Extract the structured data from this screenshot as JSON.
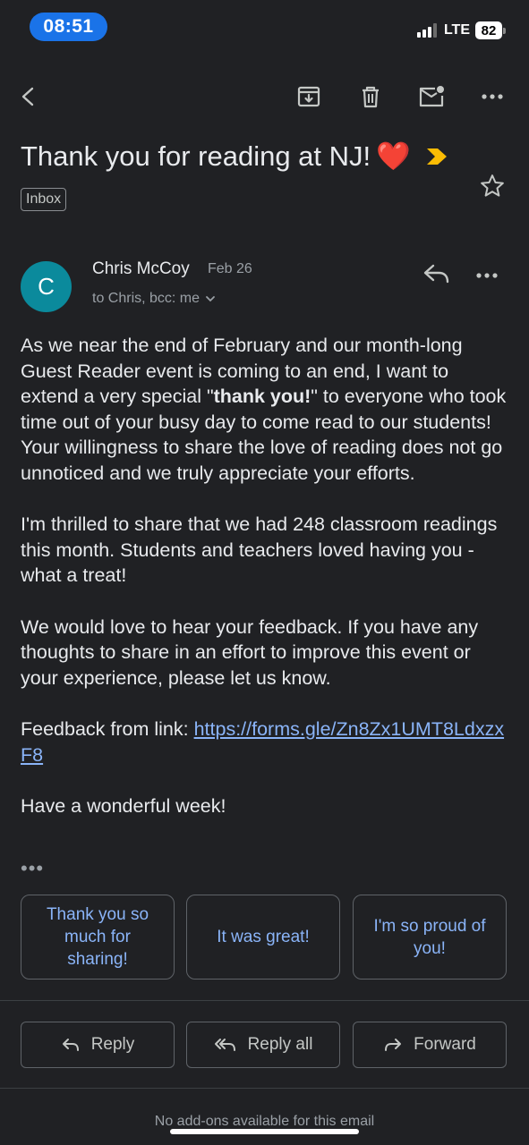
{
  "status_bar": {
    "time": "08:51",
    "network": "LTE",
    "battery": "82"
  },
  "toolbar": {
    "back": "back-icon",
    "archive": "archive-icon",
    "delete": "trash-icon",
    "mark_unread": "mail-unread-icon",
    "more": "more-icon"
  },
  "email": {
    "subject": "Thank you for reading at NJ!",
    "subject_emoji": "❤️",
    "label": "Inbox",
    "sender": {
      "initial": "C",
      "name": "Chris McCoy",
      "date": "Feb 26",
      "recipients": "to Chris, bcc: me"
    },
    "body": {
      "p1_before": "As we near the end of February and our month-long Guest Reader event is coming to an end, I want to extend a very special \"",
      "p1_bold": "thank you!",
      "p1_after": "\" to everyone who took time out of your busy day to come read to our students! Your willingness to share the love of reading does not go unnoticed and we truly appreciate your efforts.",
      "p2": "I'm thrilled to share that we had 248 classroom readings this month. Students and teachers loved having you - what a treat!",
      "p3": "We would love to hear your feedback. If you have any thoughts to share in an effort to improve this event or your experience, please let us know.",
      "p4_label": "Feedback from link: ",
      "p4_link": "https://forms.gle/Zn8Zx1UMT8LdxzxF8",
      "p5": "Have a wonderful week!",
      "trimmed": "•••"
    }
  },
  "smart_replies": [
    "Thank you so much for sharing!",
    "It was great!",
    "I'm so proud of you!"
  ],
  "actions": {
    "reply": "Reply",
    "reply_all": "Reply all",
    "forward": "Forward"
  },
  "footer": {
    "addons": "No add-ons available for this email"
  },
  "colors": {
    "background": "#202124",
    "accent": "#8ab4f8",
    "avatar": "#0b8a9c",
    "importance": "#fbbc04"
  }
}
